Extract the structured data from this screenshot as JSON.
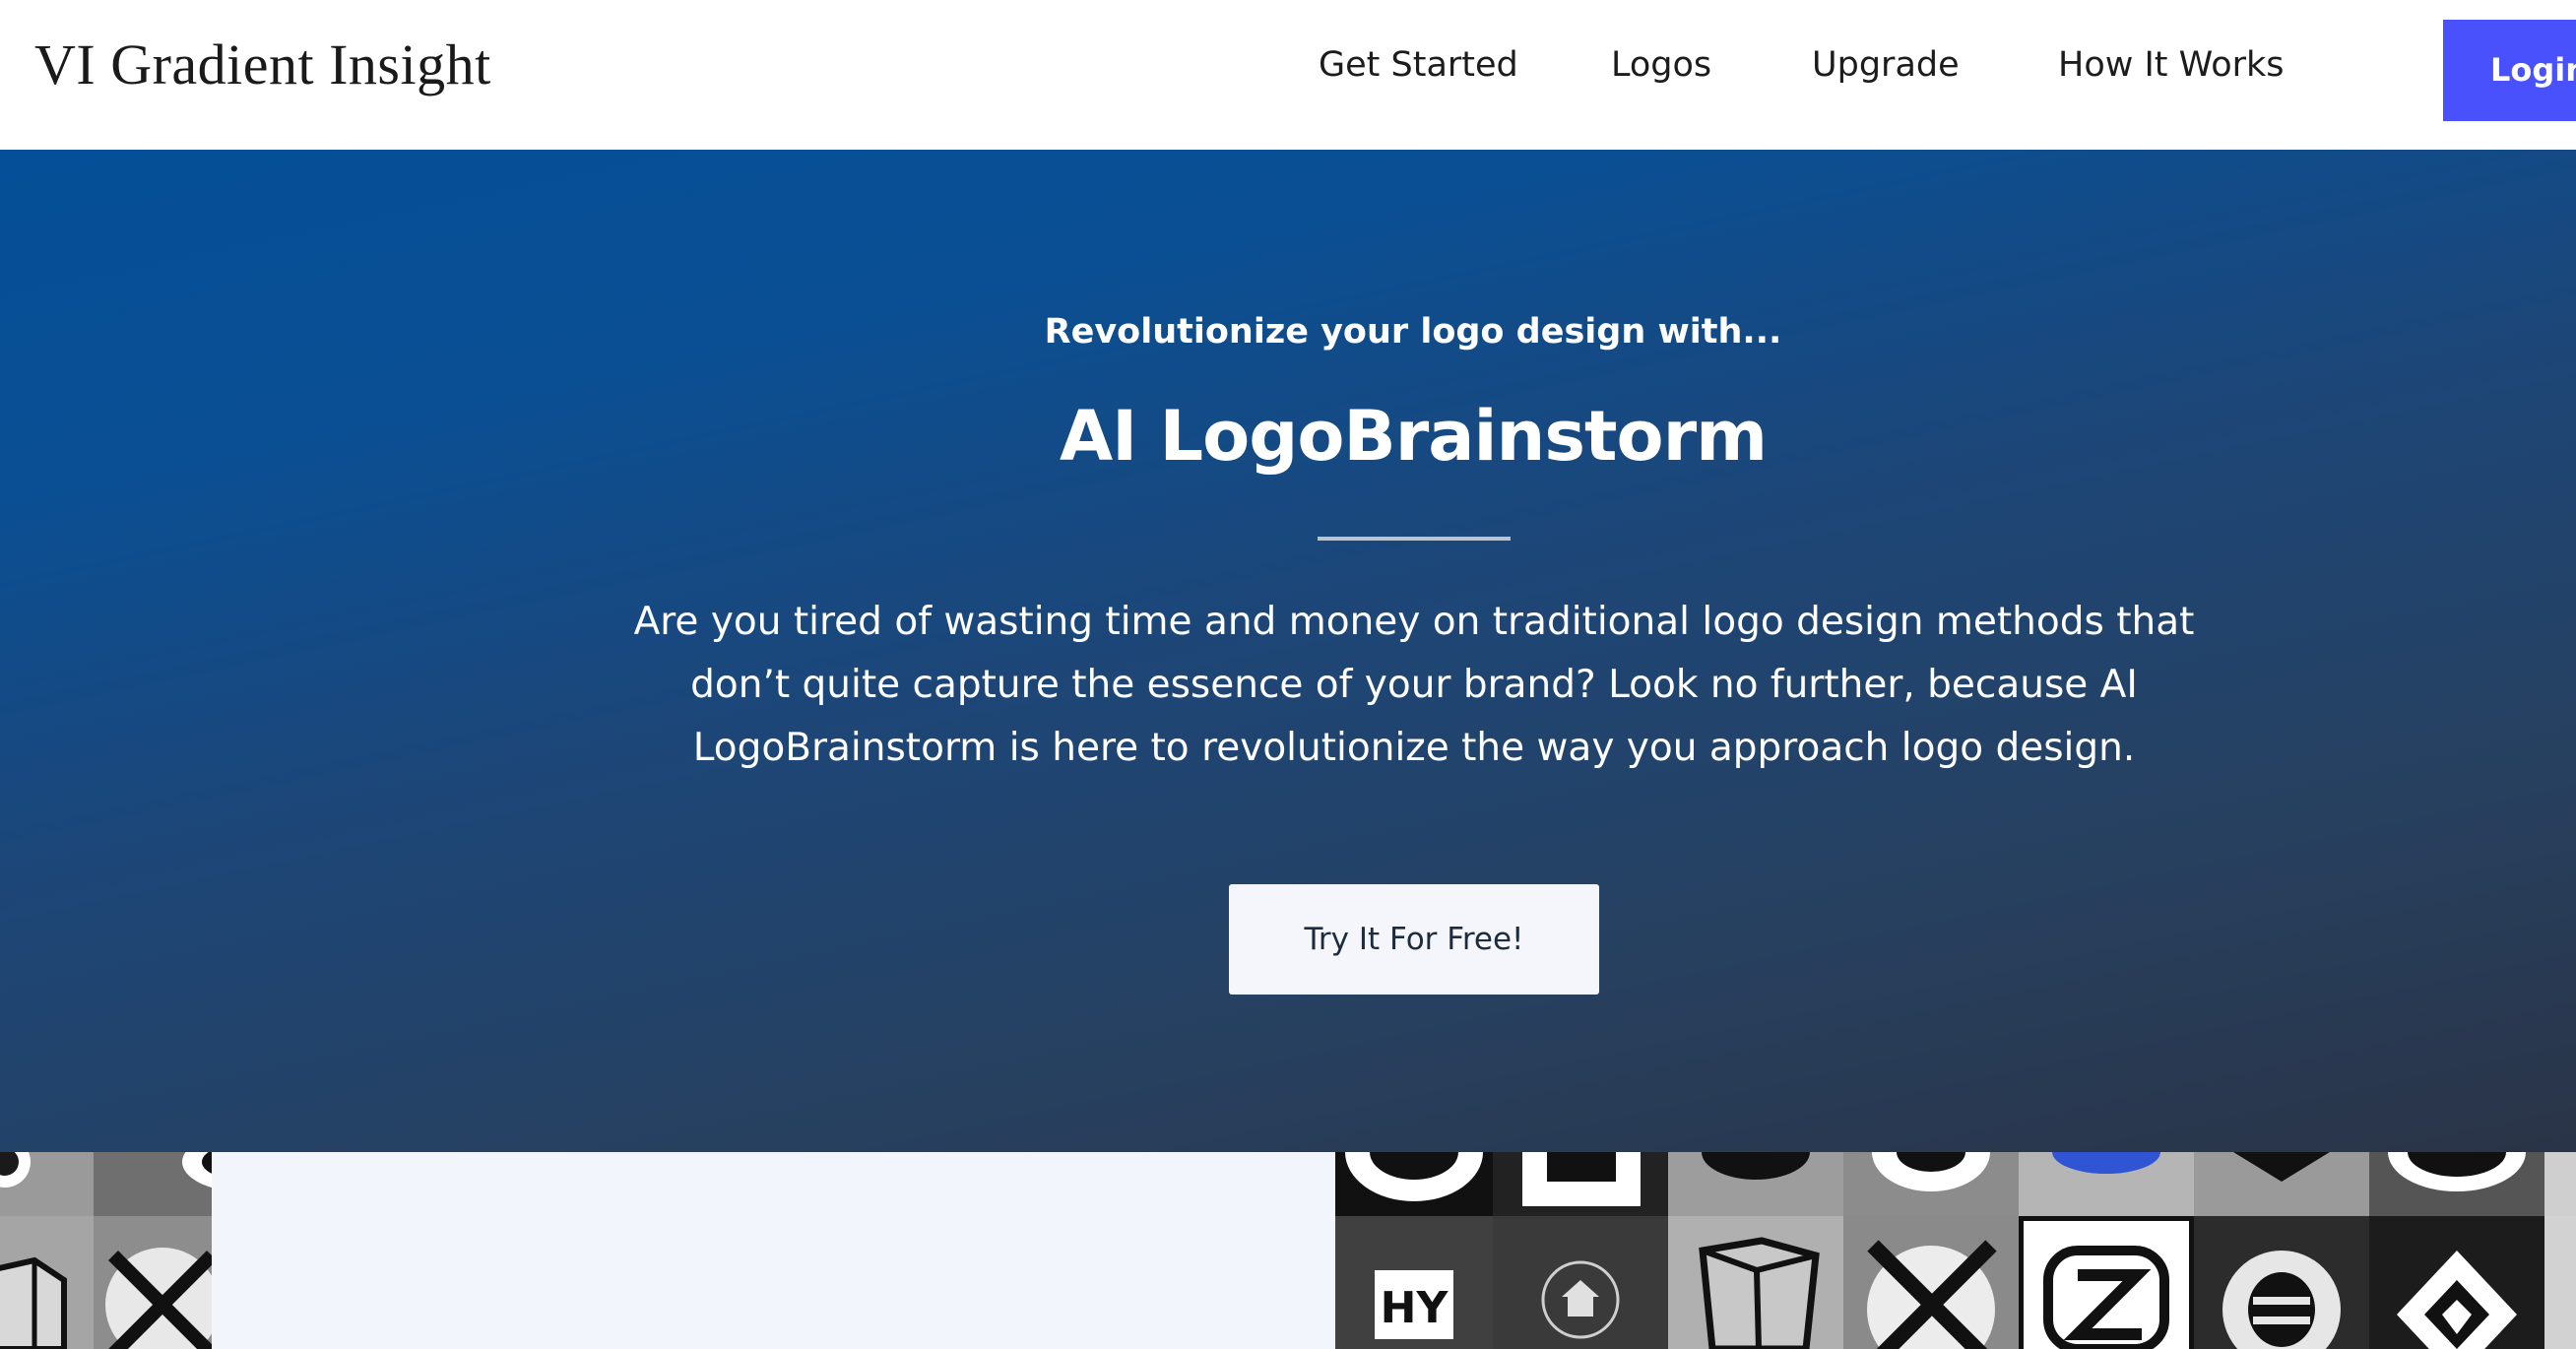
{
  "header": {
    "brand": "VI Gradient Insight",
    "nav": [
      {
        "label": "Get Started",
        "name": "nav-get-started"
      },
      {
        "label": "Logos",
        "name": "nav-logos"
      },
      {
        "label": "Upgrade",
        "name": "nav-upgrade"
      },
      {
        "label": "How It Works",
        "name": "nav-how-it-works"
      }
    ],
    "login_label": "Login",
    "login_color": "#4951fc"
  },
  "hero": {
    "eyebrow": "Revolutionize your logo design with...",
    "title": "AI LogoBrainstorm",
    "description": "Are you tired of wasting time and money on traditional logo design methods that don’t quite capture the essence of your brand? Look no further, because AI LogoBrainstorm is here to revolutionize the way you approach logo design.",
    "cta_label": "Try It For Free!",
    "gradient_top": "#044f97",
    "gradient_bottom": "#2a3447"
  },
  "gallery": {
    "tiles": [
      {
        "icon": "circle-logo-icon"
      },
      {
        "icon": "cube-logo-icon"
      },
      {
        "icon": "crossed-tools-logo-icon"
      },
      {
        "icon": "letter-logo-icon"
      },
      {
        "icon": "house-logo-icon"
      },
      {
        "icon": "z-monogram-logo-icon"
      },
      {
        "icon": "stacked-bars-logo-icon"
      },
      {
        "icon": "diamond-logo-icon"
      }
    ]
  }
}
